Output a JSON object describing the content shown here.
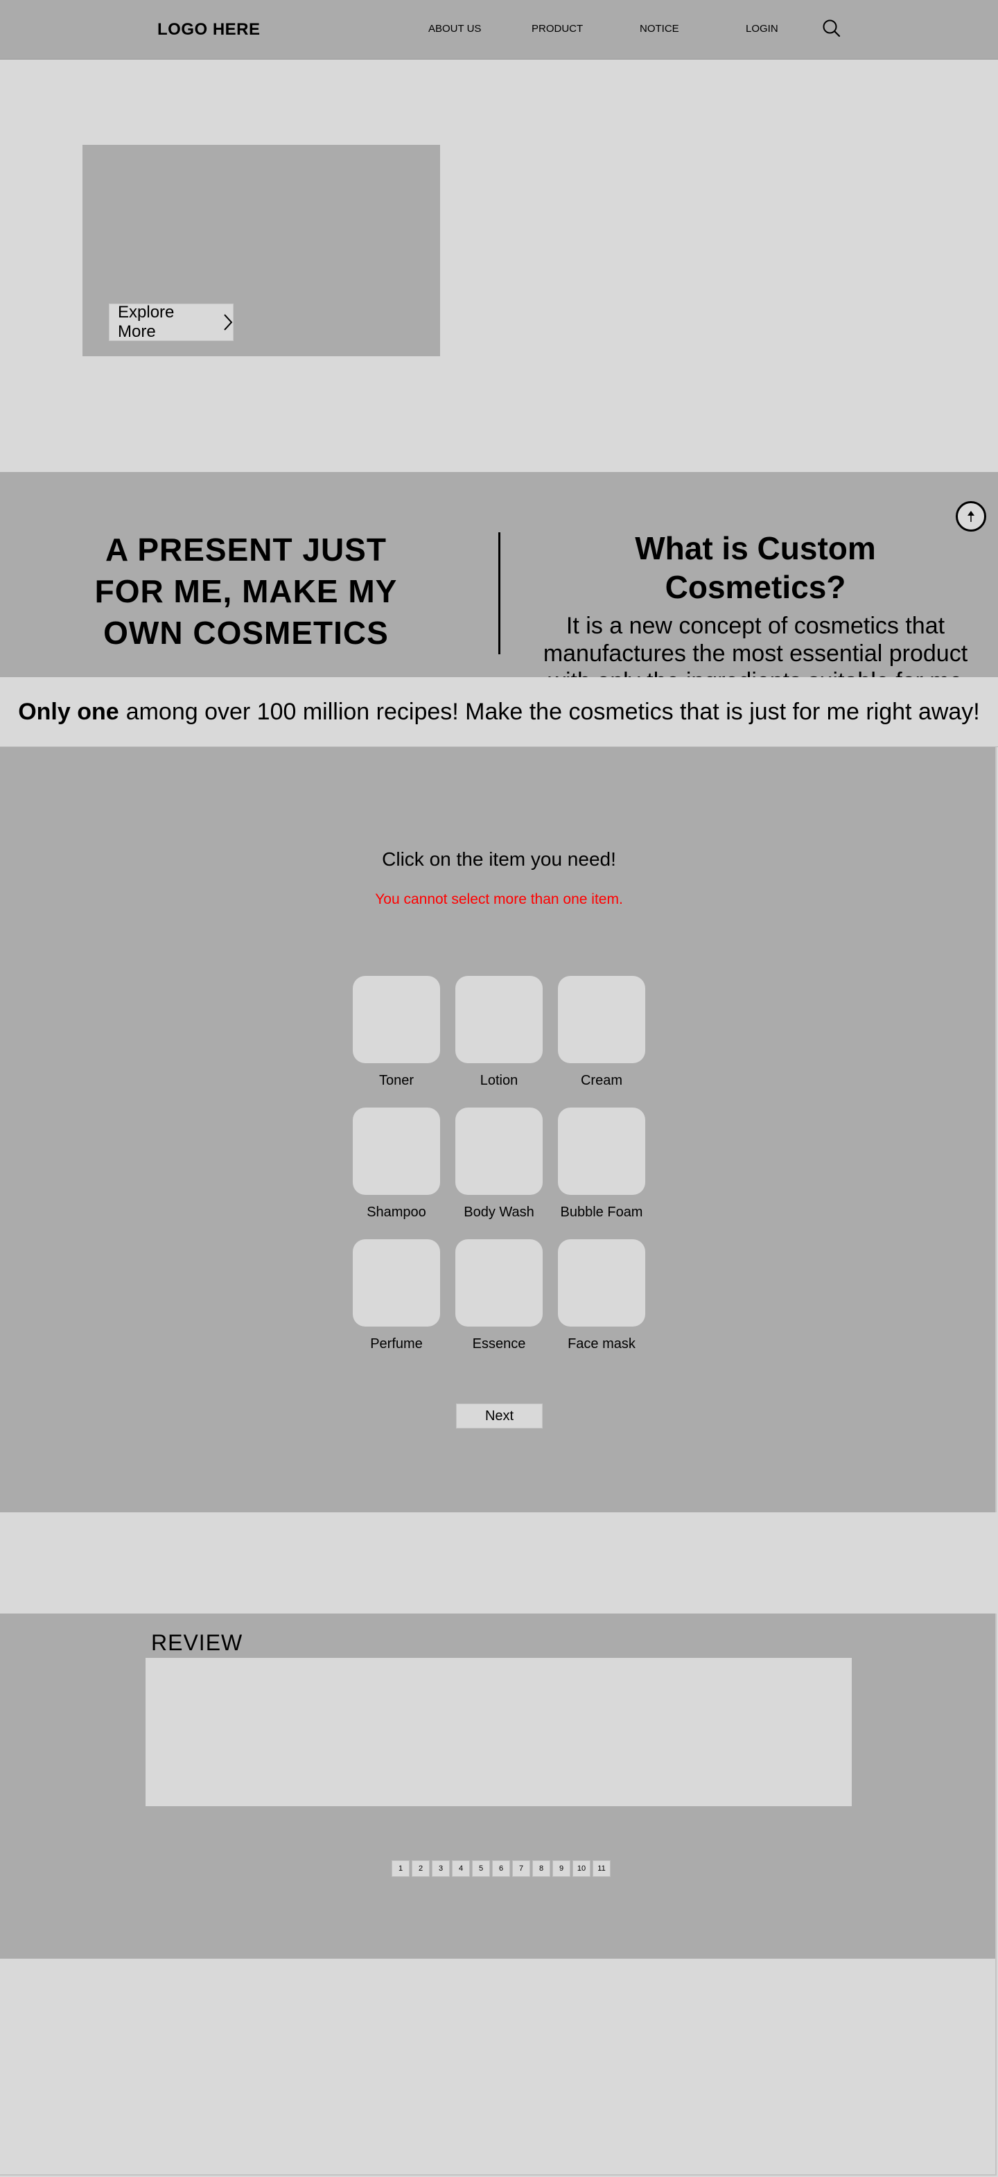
{
  "header": {
    "logo": "LOGO HERE",
    "nav": [
      "ABOUT US",
      "PRODUCT",
      "NOTICE",
      "LOGIN"
    ],
    "search_icon": "search-icon"
  },
  "hero": {
    "explore_label": "Explore More",
    "explore_icon": "chevron-right-icon"
  },
  "scroll_top_icon": "arrow-up-icon",
  "intro": {
    "headline_lines": [
      "A PRESENT JUST",
      "FOR ME, MAKE MY",
      "OWN COSMETICS"
    ],
    "question": "What is Custom Cosmetics?",
    "description": "It is a new concept of cosmetics that manufactures the most essential product with only the ingredients suitable for me"
  },
  "tagline": {
    "bold": "Only one",
    "rest": "among over 100 million recipes! Make the cosmetics that is just for me right away!"
  },
  "selector": {
    "title": "Click on the item you need!",
    "warning": "You cannot select more than one item.",
    "items": [
      "Toner",
      "Lotion",
      "Cream",
      "Shampoo",
      "Body Wash",
      "Bubble Foam",
      "Perfume",
      "Essence",
      "Face mask"
    ],
    "next_label": "Next"
  },
  "review": {
    "title": "REVIEW",
    "pages": [
      "1",
      "2",
      "3",
      "4",
      "5",
      "6",
      "7",
      "8",
      "9",
      "10",
      "11"
    ]
  },
  "colors": {
    "dark_gray": "#ababab",
    "light_gray": "#d9d9d9",
    "warning": "#ff0000"
  }
}
